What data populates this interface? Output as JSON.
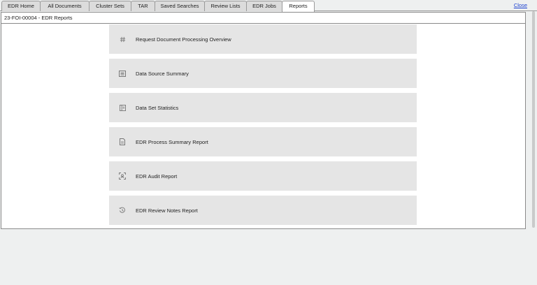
{
  "tabs": [
    {
      "label": "EDR Home",
      "active": false
    },
    {
      "label": "All Documents",
      "active": false
    },
    {
      "label": "Cluster Sets",
      "active": false
    },
    {
      "label": "TAR",
      "active": false
    },
    {
      "label": "Saved Searches",
      "active": false
    },
    {
      "label": "Review Lists",
      "active": false
    },
    {
      "label": "EDR Jobs",
      "active": false
    },
    {
      "label": "Reports",
      "active": true
    }
  ],
  "close_label": "Close",
  "panel": {
    "title": "23-FOI-00004 - EDR Reports"
  },
  "reports": [
    {
      "label": "Request Document Processing Overview",
      "icon": "hash-icon"
    },
    {
      "label": "Data Source Summary",
      "icon": "list-icon"
    },
    {
      "label": "Data Set Statistics",
      "icon": "table-icon"
    },
    {
      "label": "EDR Process Summary Report",
      "icon": "document-icon"
    },
    {
      "label": "EDR Audit Report",
      "icon": "scan-icon"
    },
    {
      "label": "EDR Review Notes Report",
      "icon": "history-icon"
    }
  ]
}
